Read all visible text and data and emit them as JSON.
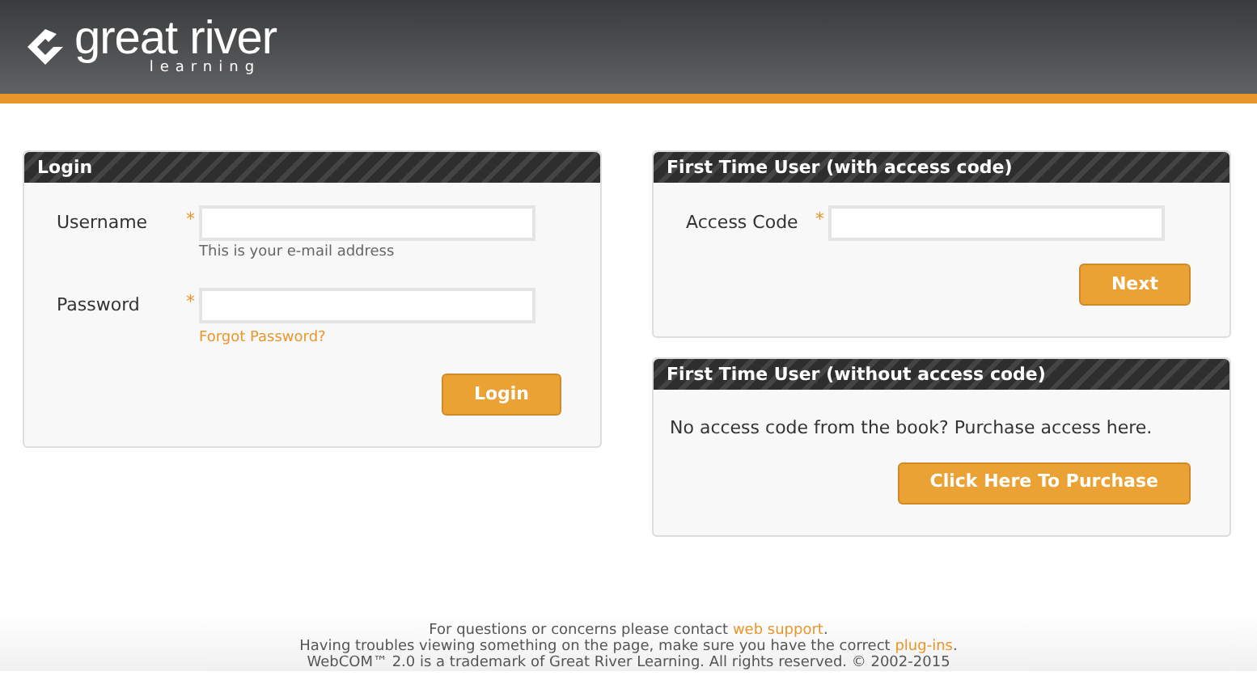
{
  "header": {
    "logo_title": "great river",
    "logo_subtitle": "learning"
  },
  "login_panel": {
    "title": "Login",
    "fields": [
      {
        "label": "Username",
        "required_mark": "*",
        "hint": "This is your e-mail address",
        "kind": "note"
      },
      {
        "label": "Password",
        "required_mark": "*",
        "hint": "Forgot Password?",
        "kind": "link"
      }
    ],
    "button": "Login"
  },
  "access_code_panel": {
    "title": "First Time User (with access code)",
    "fields": [
      {
        "label": "Access Code",
        "required_mark": "*"
      }
    ],
    "button": "Next"
  },
  "purchase_panel": {
    "title": "First Time User (without access code)",
    "text": "No access code from the book? Purchase access here.",
    "button": "Click Here To Purchase"
  },
  "footer": [
    {
      "text": "For questions or concerns please contact",
      "link": "web support",
      "after": "."
    },
    {
      "text": "Having troubles viewing something on the page, make sure you have the correct",
      "link": "plug-ins",
      "after": "."
    },
    {
      "text": "WebCOM™ 2.0 is a trademark of Great River Learning. All rights reserved. © 2002-2015"
    }
  ]
}
